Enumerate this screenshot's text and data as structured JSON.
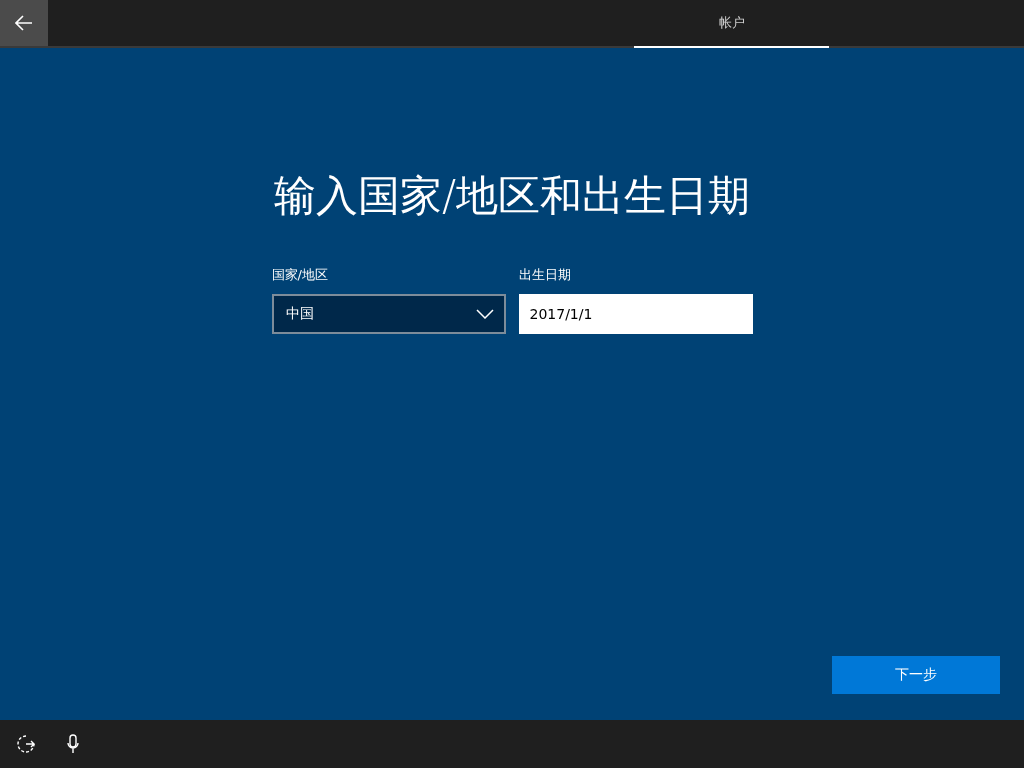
{
  "top_bar": {
    "back_button": true,
    "tabs": [
      {
        "label": "帐户",
        "selected": true
      }
    ]
  },
  "title": "输入国家/地区和出生日期",
  "fields": [
    {
      "kind": "dropdown",
      "label": "国家/地区",
      "value": "中国"
    },
    {
      "kind": "text",
      "label": "出生日期",
      "value": "2017/1/1"
    }
  ],
  "next_button": "下一步"
}
